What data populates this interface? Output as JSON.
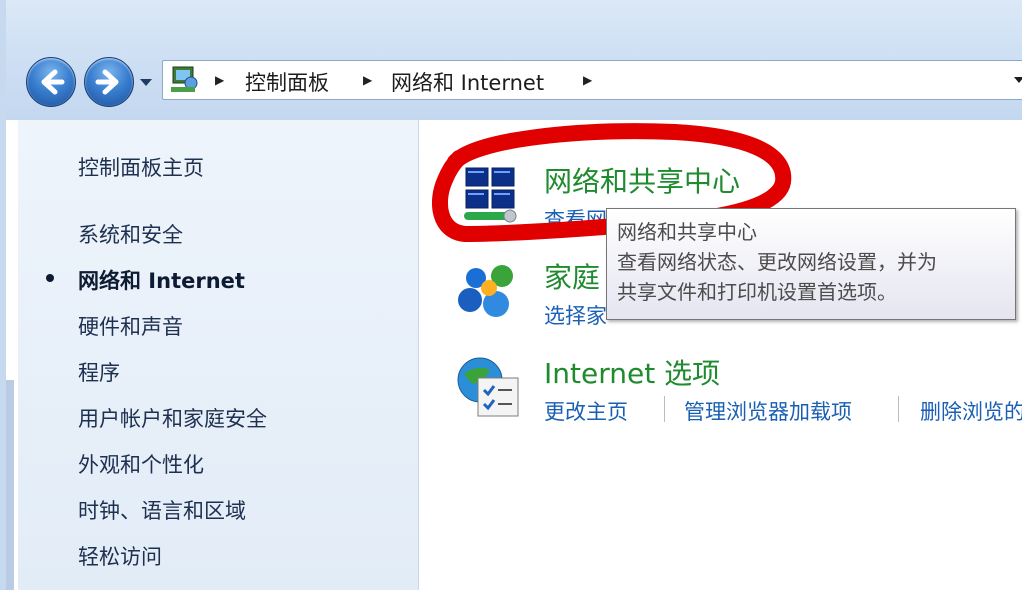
{
  "address_bar": {
    "breadcrumbs": [
      "控制面板",
      "网络和 Internet"
    ]
  },
  "sidebar": {
    "items": [
      {
        "label": "控制面板主页"
      },
      {
        "label": "系统和安全"
      },
      {
        "label": "网络和 Internet",
        "current": true
      },
      {
        "label": "硬件和声音"
      },
      {
        "label": "程序"
      },
      {
        "label": "用户帐户和家庭安全"
      },
      {
        "label": "外观和个性化"
      },
      {
        "label": "时钟、语言和区域"
      },
      {
        "label": "轻松访问"
      }
    ]
  },
  "categories": [
    {
      "title": "网络和共享中心",
      "icon": "network-sharing-center-icon",
      "links": [
        "查看网"
      ]
    },
    {
      "title": "家庭",
      "icon": "homegroup-icon",
      "links": [
        "选择家"
      ]
    },
    {
      "title": "Internet 选项",
      "icon": "internet-options-icon",
      "links": [
        "更改主页",
        "管理浏览器加载项",
        "删除浏览的"
      ]
    }
  ],
  "tooltip": {
    "title": "网络和共享中心",
    "line1": "查看网络状态、更改网络设置，并为",
    "line2": "共享文件和打印机设置首选项。"
  },
  "colors": {
    "category_title": "#1f8a2e",
    "link": "#1a5fb4",
    "highlight_mark": "#e00000"
  }
}
